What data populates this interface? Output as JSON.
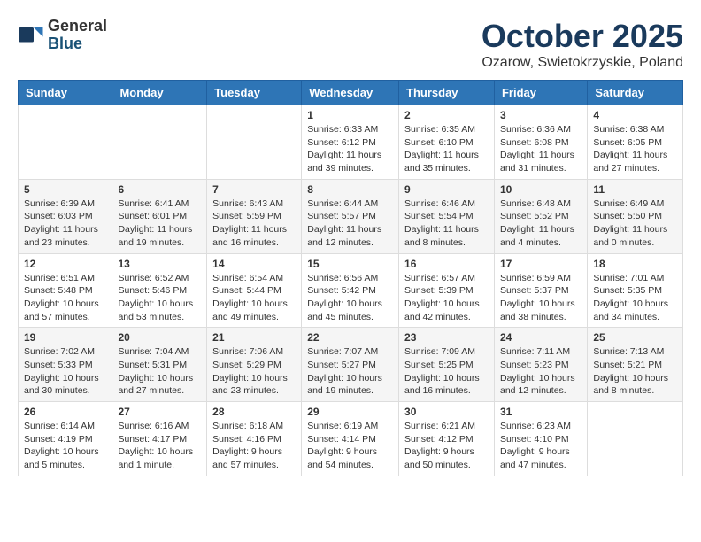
{
  "logo": {
    "general": "General",
    "blue": "Blue"
  },
  "title": "October 2025",
  "location": "Ozarow, Swietokrzyskie, Poland",
  "days_of_week": [
    "Sunday",
    "Monday",
    "Tuesday",
    "Wednesday",
    "Thursday",
    "Friday",
    "Saturday"
  ],
  "weeks": [
    [
      {
        "num": "",
        "info": ""
      },
      {
        "num": "",
        "info": ""
      },
      {
        "num": "",
        "info": ""
      },
      {
        "num": "1",
        "info": "Sunrise: 6:33 AM\nSunset: 6:12 PM\nDaylight: 11 hours\nand 39 minutes."
      },
      {
        "num": "2",
        "info": "Sunrise: 6:35 AM\nSunset: 6:10 PM\nDaylight: 11 hours\nand 35 minutes."
      },
      {
        "num": "3",
        "info": "Sunrise: 6:36 AM\nSunset: 6:08 PM\nDaylight: 11 hours\nand 31 minutes."
      },
      {
        "num": "4",
        "info": "Sunrise: 6:38 AM\nSunset: 6:05 PM\nDaylight: 11 hours\nand 27 minutes."
      }
    ],
    [
      {
        "num": "5",
        "info": "Sunrise: 6:39 AM\nSunset: 6:03 PM\nDaylight: 11 hours\nand 23 minutes."
      },
      {
        "num": "6",
        "info": "Sunrise: 6:41 AM\nSunset: 6:01 PM\nDaylight: 11 hours\nand 19 minutes."
      },
      {
        "num": "7",
        "info": "Sunrise: 6:43 AM\nSunset: 5:59 PM\nDaylight: 11 hours\nand 16 minutes."
      },
      {
        "num": "8",
        "info": "Sunrise: 6:44 AM\nSunset: 5:57 PM\nDaylight: 11 hours\nand 12 minutes."
      },
      {
        "num": "9",
        "info": "Sunrise: 6:46 AM\nSunset: 5:54 PM\nDaylight: 11 hours\nand 8 minutes."
      },
      {
        "num": "10",
        "info": "Sunrise: 6:48 AM\nSunset: 5:52 PM\nDaylight: 11 hours\nand 4 minutes."
      },
      {
        "num": "11",
        "info": "Sunrise: 6:49 AM\nSunset: 5:50 PM\nDaylight: 11 hours\nand 0 minutes."
      }
    ],
    [
      {
        "num": "12",
        "info": "Sunrise: 6:51 AM\nSunset: 5:48 PM\nDaylight: 10 hours\nand 57 minutes."
      },
      {
        "num": "13",
        "info": "Sunrise: 6:52 AM\nSunset: 5:46 PM\nDaylight: 10 hours\nand 53 minutes."
      },
      {
        "num": "14",
        "info": "Sunrise: 6:54 AM\nSunset: 5:44 PM\nDaylight: 10 hours\nand 49 minutes."
      },
      {
        "num": "15",
        "info": "Sunrise: 6:56 AM\nSunset: 5:42 PM\nDaylight: 10 hours\nand 45 minutes."
      },
      {
        "num": "16",
        "info": "Sunrise: 6:57 AM\nSunset: 5:39 PM\nDaylight: 10 hours\nand 42 minutes."
      },
      {
        "num": "17",
        "info": "Sunrise: 6:59 AM\nSunset: 5:37 PM\nDaylight: 10 hours\nand 38 minutes."
      },
      {
        "num": "18",
        "info": "Sunrise: 7:01 AM\nSunset: 5:35 PM\nDaylight: 10 hours\nand 34 minutes."
      }
    ],
    [
      {
        "num": "19",
        "info": "Sunrise: 7:02 AM\nSunset: 5:33 PM\nDaylight: 10 hours\nand 30 minutes."
      },
      {
        "num": "20",
        "info": "Sunrise: 7:04 AM\nSunset: 5:31 PM\nDaylight: 10 hours\nand 27 minutes."
      },
      {
        "num": "21",
        "info": "Sunrise: 7:06 AM\nSunset: 5:29 PM\nDaylight: 10 hours\nand 23 minutes."
      },
      {
        "num": "22",
        "info": "Sunrise: 7:07 AM\nSunset: 5:27 PM\nDaylight: 10 hours\nand 19 minutes."
      },
      {
        "num": "23",
        "info": "Sunrise: 7:09 AM\nSunset: 5:25 PM\nDaylight: 10 hours\nand 16 minutes."
      },
      {
        "num": "24",
        "info": "Sunrise: 7:11 AM\nSunset: 5:23 PM\nDaylight: 10 hours\nand 12 minutes."
      },
      {
        "num": "25",
        "info": "Sunrise: 7:13 AM\nSunset: 5:21 PM\nDaylight: 10 hours\nand 8 minutes."
      }
    ],
    [
      {
        "num": "26",
        "info": "Sunrise: 6:14 AM\nSunset: 4:19 PM\nDaylight: 10 hours\nand 5 minutes."
      },
      {
        "num": "27",
        "info": "Sunrise: 6:16 AM\nSunset: 4:17 PM\nDaylight: 10 hours\nand 1 minute."
      },
      {
        "num": "28",
        "info": "Sunrise: 6:18 AM\nSunset: 4:16 PM\nDaylight: 9 hours\nand 57 minutes."
      },
      {
        "num": "29",
        "info": "Sunrise: 6:19 AM\nSunset: 4:14 PM\nDaylight: 9 hours\nand 54 minutes."
      },
      {
        "num": "30",
        "info": "Sunrise: 6:21 AM\nSunset: 4:12 PM\nDaylight: 9 hours\nand 50 minutes."
      },
      {
        "num": "31",
        "info": "Sunrise: 6:23 AM\nSunset: 4:10 PM\nDaylight: 9 hours\nand 47 minutes."
      },
      {
        "num": "",
        "info": ""
      }
    ]
  ]
}
